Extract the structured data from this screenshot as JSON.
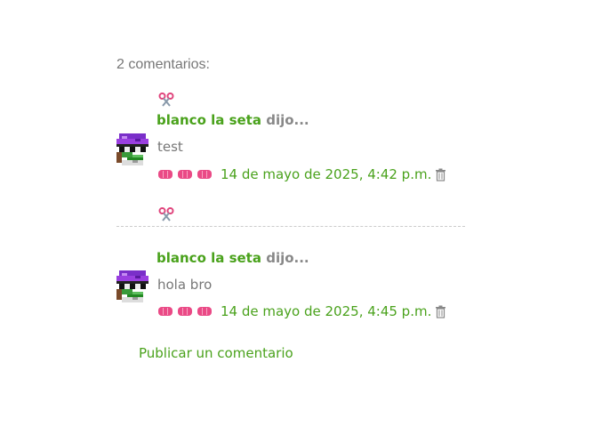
{
  "comments_header": {
    "count_label": "2 comentarios:"
  },
  "comments": [
    {
      "author": "blanco la seta",
      "said": " dijo...",
      "body": "test",
      "timestamp": "14 de mayo de 2025, 4:42 p.m."
    },
    {
      "author": "blanco la seta",
      "said": " dijo...",
      "body": "hola bro",
      "timestamp": "14 de mayo de 2025, 4:45 p.m."
    }
  ],
  "actions": {
    "post_comment_label": "Publicar un comentario"
  },
  "colors": {
    "link_green": "#4aa21c",
    "muted_text": "#777777",
    "pill_pink": "#ea4a86",
    "divider": "#cccccc"
  },
  "icons": {
    "reply": "scissors-icon",
    "delete": "trash-icon",
    "rating": "ticket-pill-icon"
  }
}
